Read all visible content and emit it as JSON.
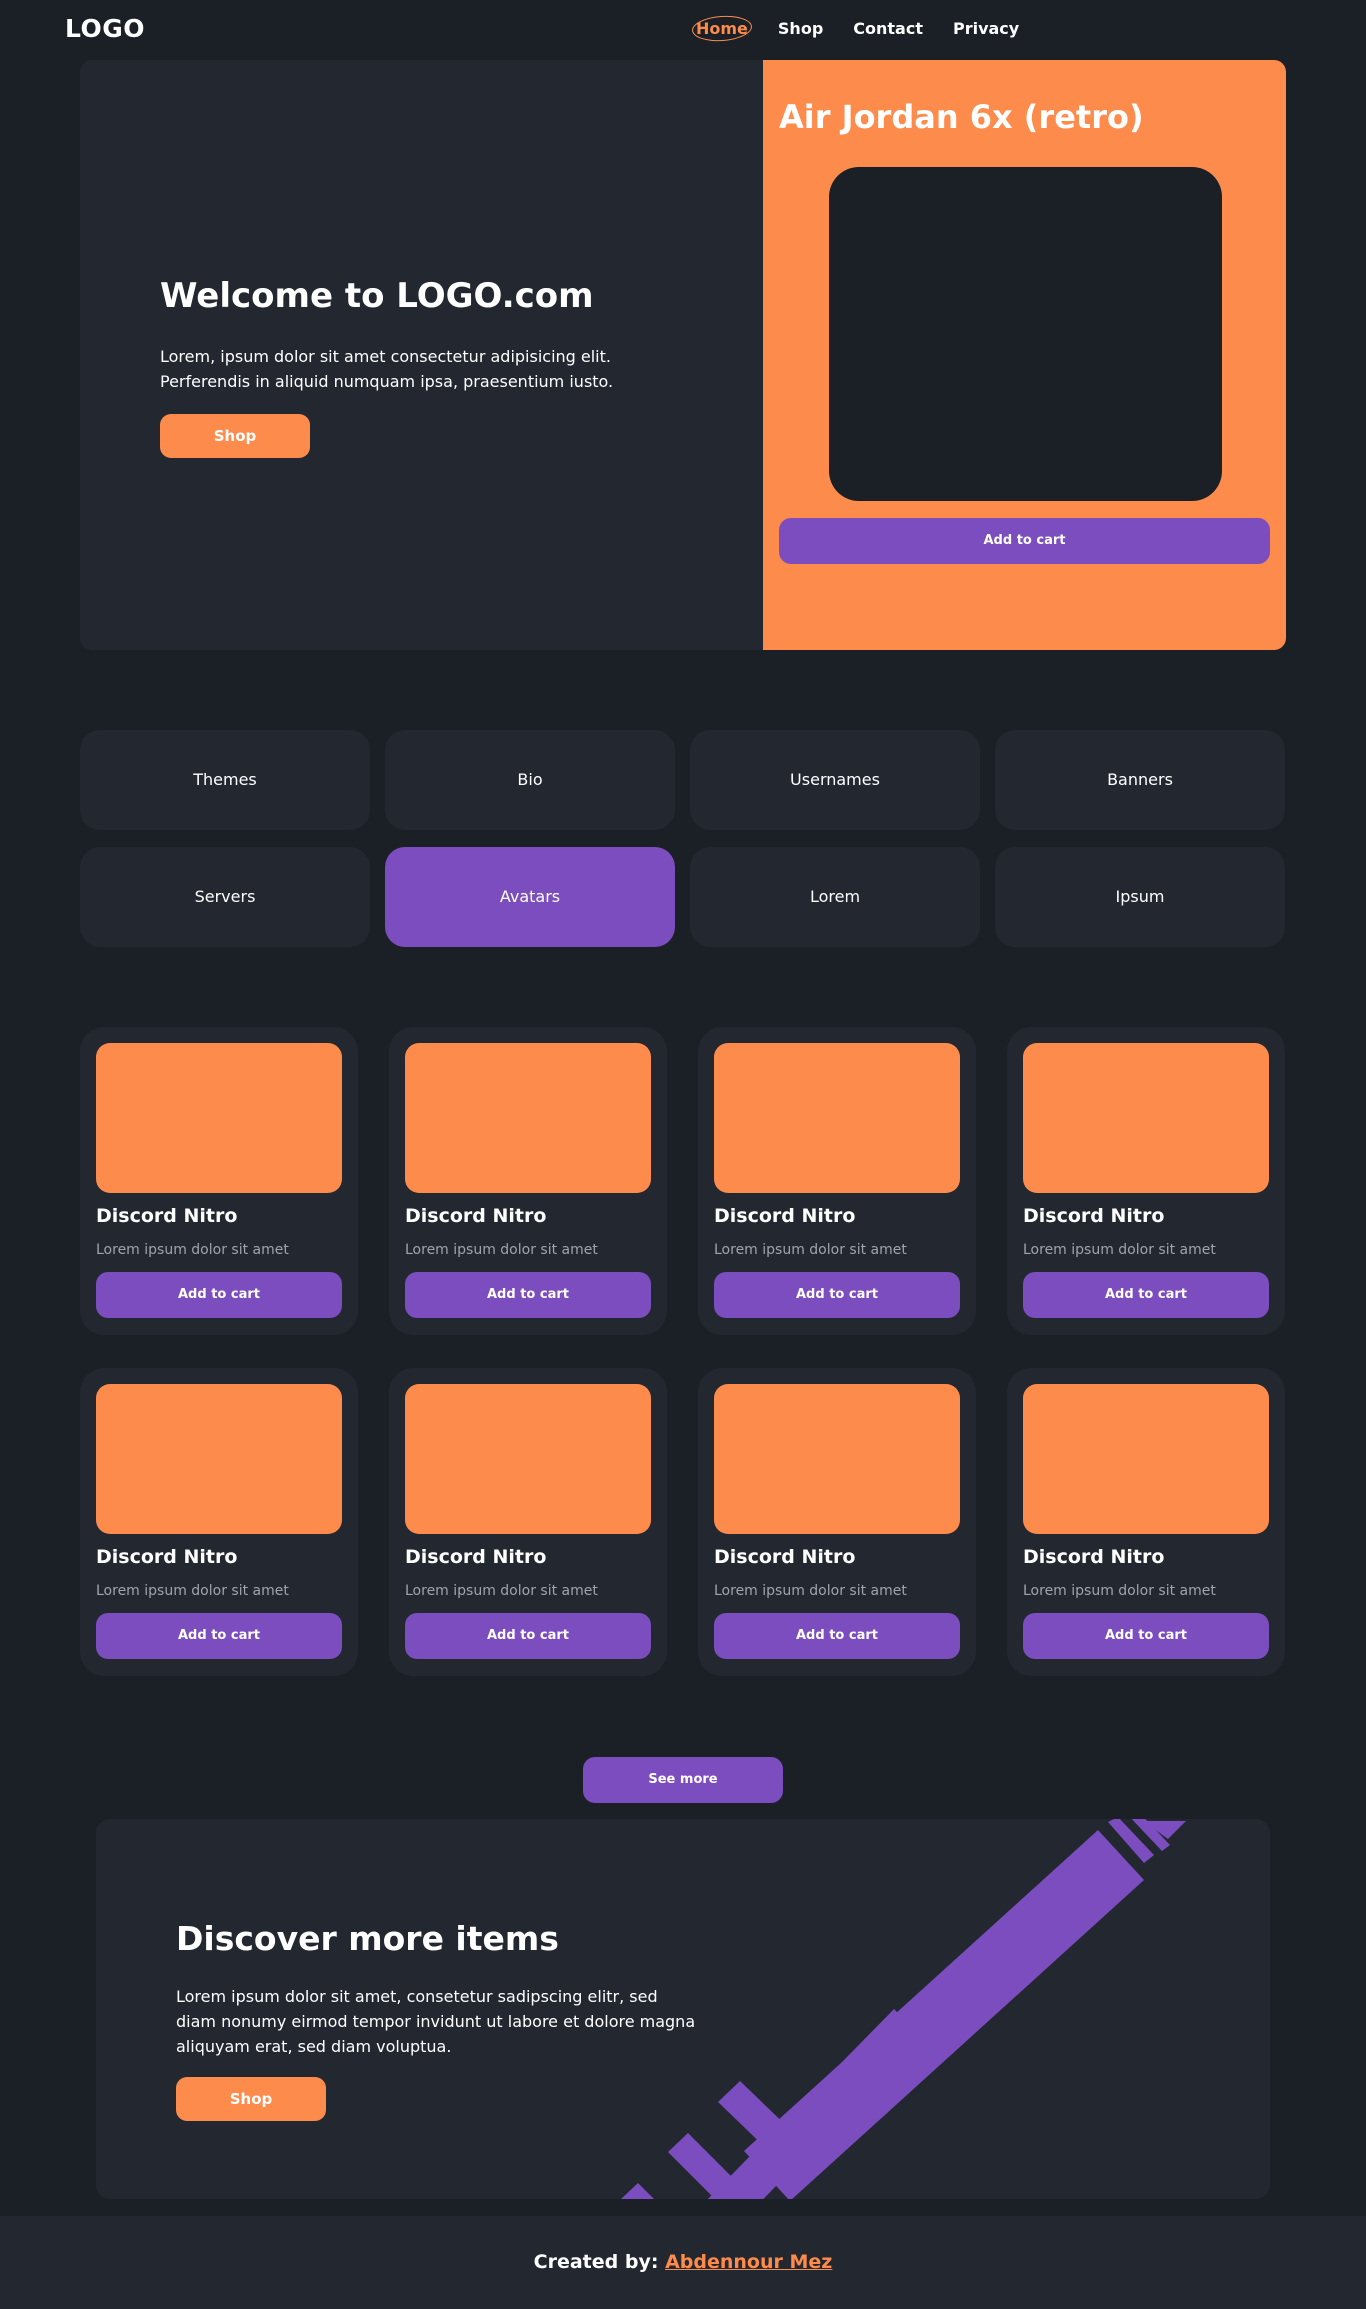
{
  "nav": {
    "logo": "LOGO",
    "links": [
      {
        "label": "Home",
        "active": true
      },
      {
        "label": "Shop",
        "active": false
      },
      {
        "label": "Contact",
        "active": false
      },
      {
        "label": "Privacy",
        "active": false
      }
    ]
  },
  "hero": {
    "title": "Welcome to LOGO.com",
    "text": "Lorem, ipsum dolor sit amet consectetur adipisicing elit. Perferendis in aliquid numquam ipsa, praesentium iusto.",
    "button": "Shop",
    "product": {
      "title": "Air Jordan 6x (retro)",
      "button": "Add to cart"
    }
  },
  "categories": [
    {
      "label": "Themes",
      "active": false
    },
    {
      "label": "Bio",
      "active": false
    },
    {
      "label": "Usernames",
      "active": false
    },
    {
      "label": "Banners",
      "active": false
    },
    {
      "label": "Servers",
      "active": false
    },
    {
      "label": "Avatars",
      "active": true
    },
    {
      "label": "Lorem",
      "active": false
    },
    {
      "label": "Ipsum",
      "active": false
    }
  ],
  "products": [
    {
      "title": "Discord Nitro",
      "text": "Lorem ipsum dolor sit amet",
      "button": "Add to cart"
    },
    {
      "title": "Discord Nitro",
      "text": "Lorem ipsum dolor sit amet",
      "button": "Add to cart"
    },
    {
      "title": "Discord Nitro",
      "text": "Lorem ipsum dolor sit amet",
      "button": "Add to cart"
    },
    {
      "title": "Discord Nitro",
      "text": "Lorem ipsum dolor sit amet",
      "button": "Add to cart"
    },
    {
      "title": "Discord Nitro",
      "text": "Lorem ipsum dolor sit amet",
      "button": "Add to cart"
    },
    {
      "title": "Discord Nitro",
      "text": "Lorem ipsum dolor sit amet",
      "button": "Add to cart"
    },
    {
      "title": "Discord Nitro",
      "text": "Lorem ipsum dolor sit amet",
      "button": "Add to cart"
    },
    {
      "title": "Discord Nitro",
      "text": "Lorem ipsum dolor sit amet",
      "button": "Add to cart"
    }
  ],
  "see_more": "See more",
  "discover": {
    "title": "Discover more items",
    "text": "Lorem ipsum dolor sit amet, consetetur sadipscing elitr, sed diam nonumy eirmod tempor invidunt ut labore et dolore magna aliquyam erat, sed diam voluptua.",
    "button": "Shop"
  },
  "footer": {
    "prefix": "Created by:",
    "author": "Abdennour Mez"
  },
  "colors": {
    "background": "#1b1f26",
    "panel": "#222730",
    "accent_orange": "#fd8b4c",
    "accent_purple": "#7b4dbe"
  }
}
